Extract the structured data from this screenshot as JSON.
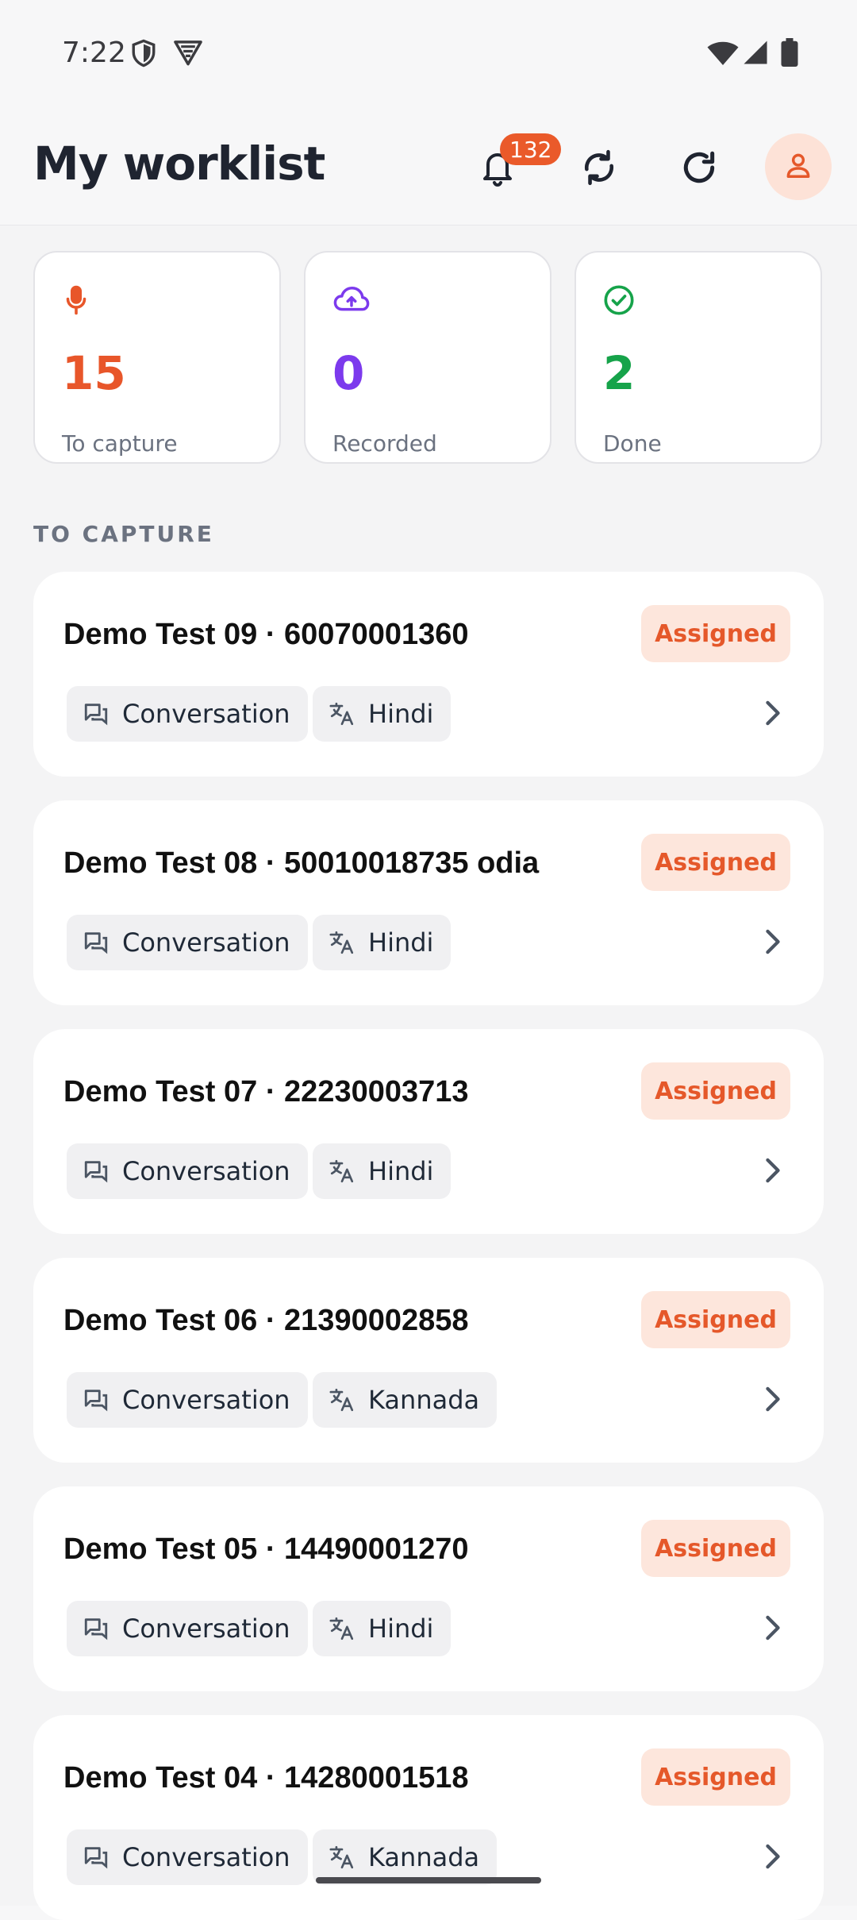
{
  "status_bar": {
    "time": "7:22"
  },
  "header": {
    "title": "My worklist",
    "notification_count": "132"
  },
  "stats": [
    {
      "value": "15",
      "label": "To capture",
      "color": "#e8562a",
      "icon": "microphone-icon"
    },
    {
      "value": "0",
      "label": "Recorded",
      "color": "#7c3aed",
      "icon": "cloud-upload-icon"
    },
    {
      "value": "2",
      "label": "Done",
      "color": "#16a34a",
      "icon": "check-circle-icon"
    }
  ],
  "section_label": "TO CAPTURE",
  "items": [
    {
      "title": "Demo Test 09 · 60070001360",
      "status": "Assigned",
      "type": "Conversation",
      "language": "Hindi"
    },
    {
      "title": "Demo Test 08 · 50010018735 odia",
      "status": "Assigned",
      "type": "Conversation",
      "language": "Hindi"
    },
    {
      "title": "Demo Test 07 · 22230003713",
      "status": "Assigned",
      "type": "Conversation",
      "language": "Hindi"
    },
    {
      "title": "Demo Test 06 · 21390002858",
      "status": "Assigned",
      "type": "Conversation",
      "language": "Kannada"
    },
    {
      "title": "Demo Test 05 · 14490001270",
      "status": "Assigned",
      "type": "Conversation",
      "language": "Hindi"
    },
    {
      "title": "Demo Test 04 · 14280001518",
      "status": "Assigned",
      "type": "Conversation",
      "language": "Kannada"
    }
  ],
  "colors": {
    "accent": "#e8562a",
    "status_bg": "#fde6dc"
  }
}
